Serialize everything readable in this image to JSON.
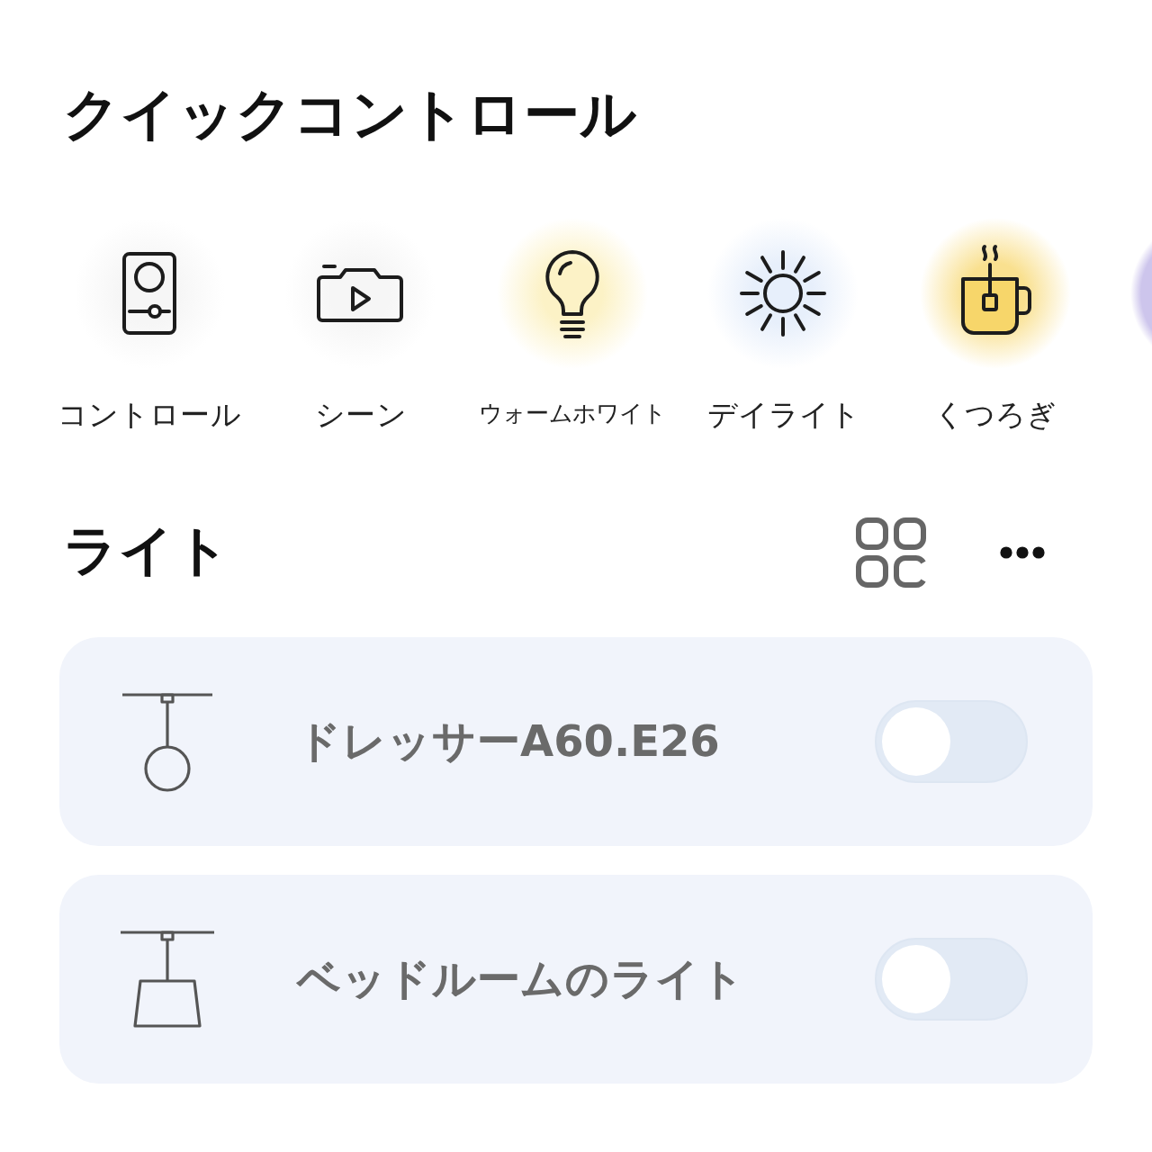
{
  "title": "クイックコントロール",
  "quick_controls": [
    {
      "kind": "panel",
      "label": "コントロール",
      "color": "#f6f6f6"
    },
    {
      "kind": "scene",
      "label": "シーン",
      "color": "#f6f6f6"
    },
    {
      "kind": "bulb",
      "label": "ウォームホワイト",
      "color": "#fcf2c6"
    },
    {
      "kind": "sun",
      "label": "デイライト",
      "color": "#e7effb"
    },
    {
      "kind": "tea",
      "label": "くつろぎ",
      "color": "#f9e08f"
    },
    {
      "kind": "cut_off",
      "color": "#cdc5ec"
    }
  ],
  "lights": {
    "title": "ライト",
    "items": [
      {
        "kind": "globe",
        "name": "ドレッサーA60.E26",
        "on": false
      },
      {
        "kind": "shade",
        "name": "ベッドルームのライト",
        "on": false
      }
    ]
  }
}
